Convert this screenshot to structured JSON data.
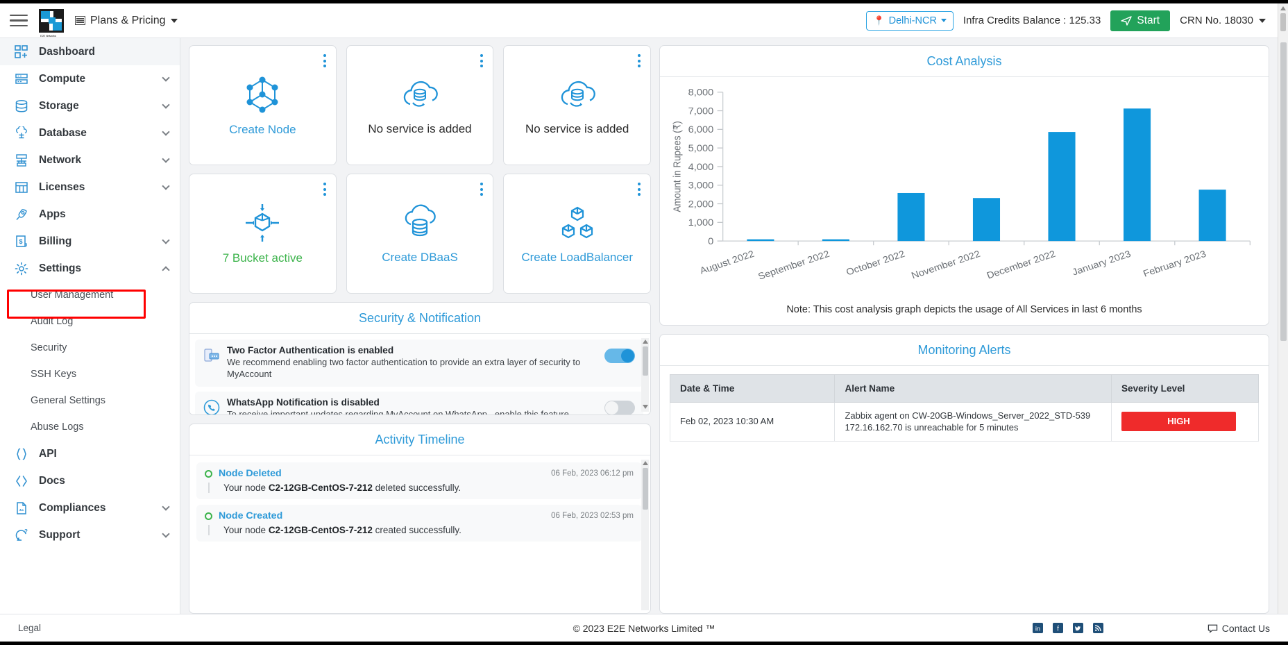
{
  "topbar": {
    "menu_icon": "hamburger-icon",
    "brand": "E2E Networks",
    "plans_label": "Plans & Pricing",
    "region": "Delhi-NCR",
    "credits": "Infra Credits Balance : 125.33",
    "start_label": "Start",
    "crn": "CRN No. 18030"
  },
  "sidebar": {
    "items": [
      {
        "label": "Dashboard",
        "icon": "dashboard-icon",
        "expandable": false,
        "active": true
      },
      {
        "label": "Compute",
        "icon": "server-icon",
        "expandable": true
      },
      {
        "label": "Storage",
        "icon": "database-stack-icon",
        "expandable": true
      },
      {
        "label": "Database",
        "icon": "cloud-database-icon",
        "expandable": true
      },
      {
        "label": "Network",
        "icon": "network-icon",
        "expandable": true
      },
      {
        "label": "Licenses",
        "icon": "grid-window-icon",
        "expandable": true
      },
      {
        "label": "Apps",
        "icon": "rocket-icon",
        "expandable": false
      },
      {
        "label": "Billing",
        "icon": "invoice-dollar-icon",
        "expandable": true
      },
      {
        "label": "Settings",
        "icon": "gear-icon",
        "expandable": true,
        "expanded": true
      }
    ],
    "settings_children": [
      {
        "label": "User Management"
      },
      {
        "label": "Audit Log",
        "highlighted": true
      },
      {
        "label": "Security"
      },
      {
        "label": "SSH Keys"
      },
      {
        "label": "General Settings"
      },
      {
        "label": "Abuse Logs"
      }
    ],
    "bottom_items": [
      {
        "label": "API",
        "icon": "braces-icon",
        "expandable": false
      },
      {
        "label": "Docs",
        "icon": "code-angle-icon",
        "expandable": false
      },
      {
        "label": "Compliances",
        "icon": "document-icon",
        "expandable": true
      },
      {
        "label": "Support",
        "icon": "support-icon",
        "expandable": true
      }
    ],
    "highlight_color": "#ff0000"
  },
  "tiles": [
    {
      "label": "Create Node",
      "icon": "node-graph-icon",
      "color": "blue"
    },
    {
      "label": "No service is added",
      "icon": "cloud-db-sync-icon",
      "color": "dark"
    },
    {
      "label": "No service is added",
      "icon": "cloud-db-sync-icon",
      "color": "dark"
    },
    {
      "label": "7 Bucket active",
      "icon": "bucket-cube-icon",
      "color": "green"
    },
    {
      "label": "Create DBaaS",
      "icon": "cloud-database-icon",
      "color": "blue"
    },
    {
      "label": "Create LoadBalancer",
      "icon": "loadbalancer-cubes-icon",
      "color": "blue"
    }
  ],
  "cost_panel": {
    "title": "Cost Analysis",
    "note": "Note: This cost analysis graph depicts the usage of All Services in last 6 months"
  },
  "chart_data": {
    "type": "bar",
    "title": "Cost Analysis",
    "xlabel": "",
    "ylabel": "Amount in Rupees (₹)",
    "categories": [
      "August 2022",
      "September 2022",
      "October 2022",
      "November 2022",
      "December 2022",
      "January 2023",
      "February 2023"
    ],
    "values": [
      50,
      50,
      2580,
      2310,
      5860,
      7120,
      2760
    ],
    "ylim": [
      0,
      8000
    ],
    "yticks": [
      0,
      1000,
      2000,
      3000,
      4000,
      5000,
      6000,
      7000,
      8000
    ],
    "ytick_labels": [
      "0",
      "1,000",
      "2,000",
      "3,000",
      "4,000",
      "5,000",
      "6,000",
      "7,000",
      "8,000"
    ],
    "bar_color": "#0f97dc",
    "grid": false,
    "legend": false
  },
  "security_panel": {
    "title": "Security & Notification",
    "rows": [
      {
        "icon": "two-factor-icon",
        "title": "Two Factor Authentication is enabled",
        "desc": "We recommend enabling two factor authentication to provide an extra layer of security to MyAccount",
        "toggle": "on"
      },
      {
        "icon": "whatsapp-icon",
        "title": "WhatsApp Notification is disabled",
        "desc": "To receive important updates regarding MyAccount on WhatsApp , enable this feature",
        "toggle": "off"
      }
    ]
  },
  "activity_panel": {
    "title": "Activity Timeline",
    "rows": [
      {
        "title": "Node Deleted",
        "time": "06 Feb, 2023 06:12 pm",
        "desc_prefix": "Your node ",
        "desc_bold": "C2-12GB-CentOS-7-212",
        "desc_suffix": " deleted successfully."
      },
      {
        "title": "Node Created",
        "time": "06 Feb, 2023 02:53 pm",
        "desc_prefix": "Your node ",
        "desc_bold": "C2-12GB-CentOS-7-212",
        "desc_suffix": " created successfully."
      }
    ]
  },
  "monitoring_panel": {
    "title": "Monitoring Alerts",
    "columns": [
      "Date & Time",
      "Alert Name",
      "Severity Level"
    ],
    "rows": [
      {
        "datetime": "Feb 02, 2023 10:30 AM",
        "alert": "Zabbix agent on CW-20GB-Windows_Server_2022_STD-539 172.16.162.70 is unreachable for 5 minutes",
        "severity": "HIGH",
        "severity_color": "#ef2b2b"
      }
    ]
  },
  "footer": {
    "legal": "Legal",
    "copyright": "© 2023 E2E Networks Limited ™",
    "socials": [
      "linkedin-icon",
      "facebook-icon",
      "twitter-icon",
      "rss-icon"
    ],
    "contact": "Contact Us"
  }
}
